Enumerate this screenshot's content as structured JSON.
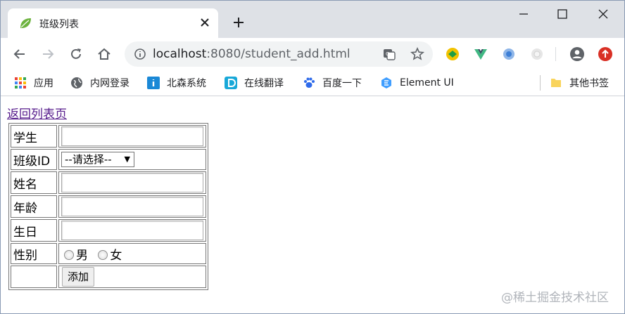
{
  "browser": {
    "tab_title": "班级列表",
    "url_host": "localhost",
    "url_path": ":8080/student_add.html"
  },
  "bookmarks": [
    {
      "label": "应用"
    },
    {
      "label": "内网登录"
    },
    {
      "label": "北森系统"
    },
    {
      "label": "在线翻译"
    },
    {
      "label": "百度一下"
    },
    {
      "label": "Element UI"
    },
    {
      "label": "其他书签"
    }
  ],
  "page": {
    "back_link": "返回列表页",
    "rows": {
      "student": "学生",
      "class_id": "班级ID",
      "name": "姓名",
      "age": "年龄",
      "birthday": "生日",
      "gender": "性别"
    },
    "class_select": "--请选择--",
    "gender_options": [
      "男",
      "女"
    ],
    "submit": "添加"
  },
  "watermark": "@稀土掘金技术社区",
  "colors": {
    "tab_strip": "#dee1e6",
    "link_visited": "#551a8b"
  }
}
